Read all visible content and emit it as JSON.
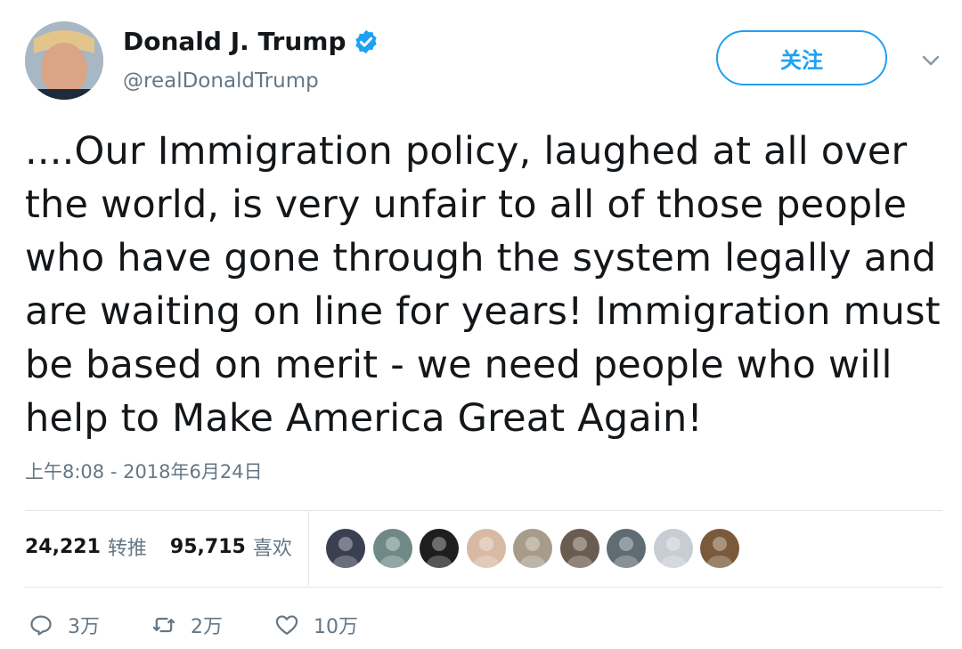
{
  "user": {
    "display_name": "Donald J. Trump",
    "handle": "@realDonaldTrump",
    "verified": true
  },
  "follow_label": "关注",
  "tweet": {
    "text": "....Our Immigration policy, laughed at all over the world, is very unfair to all of those people who have gone through the system legally and are waiting on line for years! Immigration must be based on merit - we need people who will help to Make America Great Again!",
    "timestamp": "上午8:08 - 2018年6月24日"
  },
  "stats": {
    "retweets_count": "24,221",
    "retweets_label": "转推",
    "likes_count": "95,715",
    "likes_label": "喜欢"
  },
  "likers": [
    {
      "color": "#3a3f52"
    },
    {
      "color": "#6f8a86"
    },
    {
      "color": "#1e1e1e"
    },
    {
      "color": "#d8b9a4"
    },
    {
      "color": "#a79c8a"
    },
    {
      "color": "#6b5c50"
    },
    {
      "color": "#5f6c73"
    },
    {
      "color": "#c7cdd2"
    },
    {
      "color": "#7a5a3a"
    }
  ],
  "actions": {
    "reply_count": "3万",
    "retweet_count": "2万",
    "like_count": "10万"
  },
  "colors": {
    "accent": "#1da1f2",
    "muted": "#657786",
    "text": "#14171a",
    "border": "#e1e8ed"
  }
}
